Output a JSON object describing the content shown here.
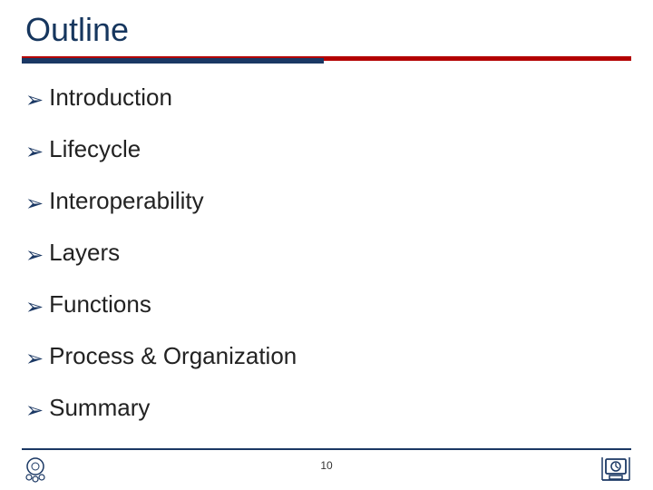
{
  "title": "Outline",
  "bullets": [
    {
      "label": "Introduction"
    },
    {
      "label": "Lifecycle"
    },
    {
      "label": "Interoperability"
    },
    {
      "label": "Layers"
    },
    {
      "label": "Functions"
    },
    {
      "label": "Process & Organization"
    },
    {
      "label": "Summary"
    }
  ],
  "page_number": "10",
  "colors": {
    "navy": "#1b3864",
    "red": "#b30000"
  }
}
